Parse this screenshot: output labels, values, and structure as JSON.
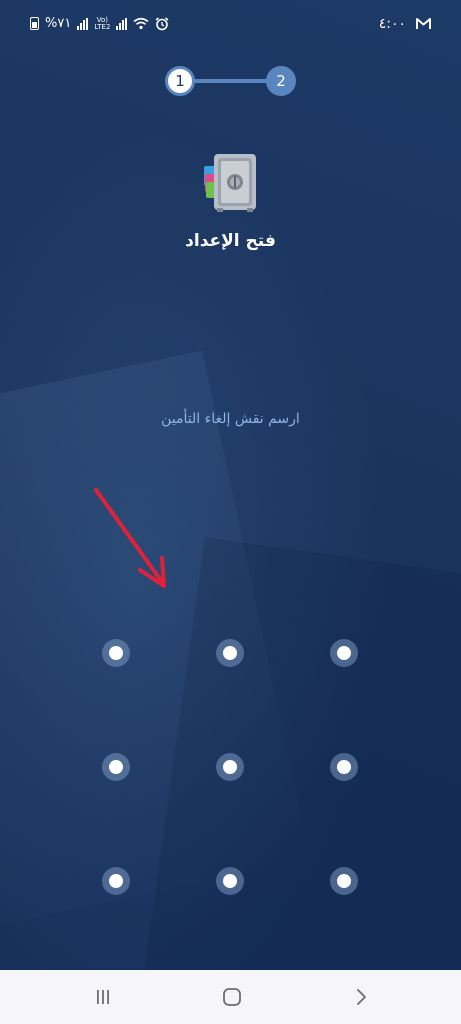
{
  "status_bar": {
    "battery_text": "%٧١",
    "network_label_top": "Vo)",
    "network_label_bottom": "LTE2",
    "time": "٤:٠٠",
    "mail_icon": "gmail-m-icon",
    "alarm_icon": "alarm-icon",
    "wifi_icon": "wifi-icon"
  },
  "stepper": {
    "step1": "1",
    "step2": "2",
    "active_color": "#5a86c0"
  },
  "app": {
    "icon": "applock-safe-icon",
    "title": "فتح الإعداد"
  },
  "instruction": "ارسم نقش إلغاء التأمين",
  "annotation": {
    "arrow_color": "#e0213a"
  },
  "pattern": {
    "rows": 3,
    "cols": 3
  },
  "nav": {
    "recents_icon": "recents-icon",
    "home_icon": "home-icon",
    "back_icon": "back-chevron-icon"
  }
}
